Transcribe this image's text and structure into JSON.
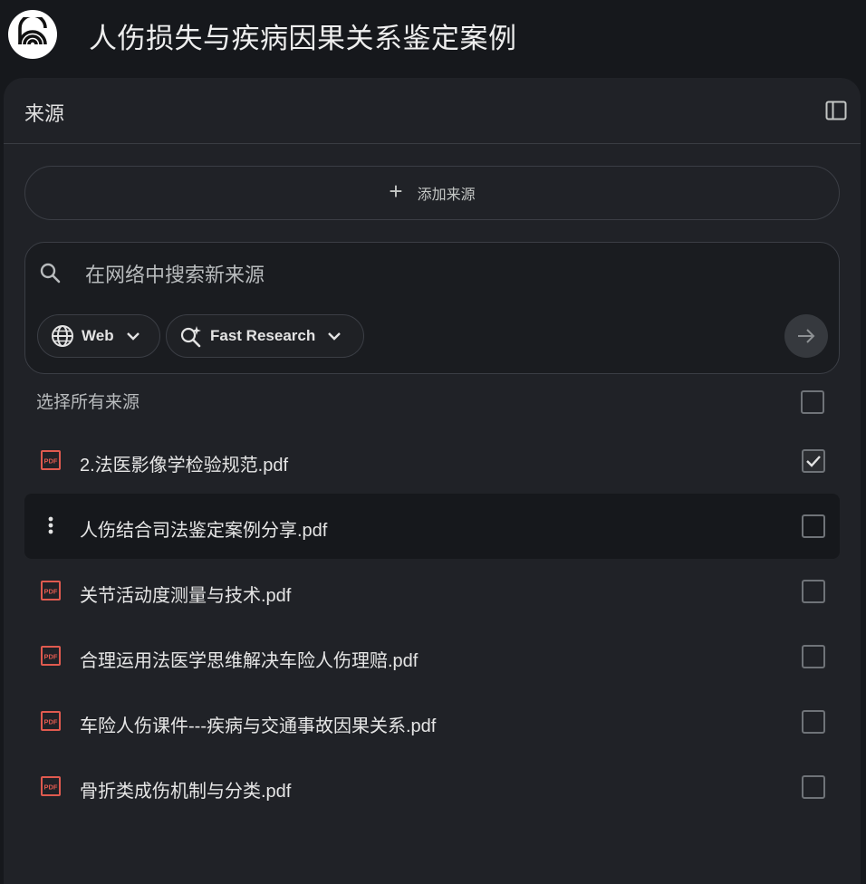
{
  "app": {
    "title": "人伤损失与疾病因果关系鉴定案例",
    "logo_icon": "notebook-logo-icon"
  },
  "sources_panel": {
    "title": "来源",
    "collapse_icon": "panel-collapse-icon",
    "add_source_label": "添加来源",
    "search": {
      "placeholder": "在网络中搜索新来源",
      "value": "",
      "source_chip": "Web",
      "mode_chip": "Fast Research"
    },
    "select_all_label": "选择所有来源",
    "select_all_checked": false,
    "items": [
      {
        "label": "2.法医影像学检验规范.pdf",
        "icon": "pdf-icon",
        "checked": true
      },
      {
        "label": "人伤结合司法鉴定案例分享.pdf",
        "icon": "more-vert-icon",
        "checked": false
      },
      {
        "label": "关节活动度测量与技术.pdf",
        "icon": "pdf-icon",
        "checked": false
      },
      {
        "label": "合理运用法医学思维解决车险人伤理赔.pdf",
        "icon": "pdf-icon",
        "checked": false
      },
      {
        "label": "车险人伤课件---疾病与交通事故因果关系.pdf",
        "icon": "pdf-icon",
        "checked": false
      },
      {
        "label": "骨折类成伤机制与分类.pdf",
        "icon": "pdf-icon",
        "checked": false
      }
    ]
  },
  "colors": {
    "background": "#16181c",
    "panel": "#202227",
    "pdf_icon": "#e05a4f",
    "text": "#e3e3e3"
  }
}
